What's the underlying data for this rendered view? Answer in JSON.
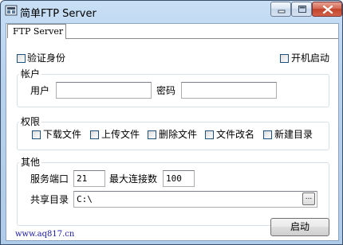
{
  "window": {
    "title": "简单FTP Server",
    "icon": "ftp-app-icon",
    "controls": [
      "minimize-icon",
      "maximize-icon",
      "close-icon"
    ]
  },
  "tabs": [
    {
      "label": "FTP Server",
      "selected": true
    }
  ],
  "options": {
    "auth": {
      "label": "验证身份",
      "checked": false
    },
    "autostart": {
      "label": "开机启动",
      "checked": false
    }
  },
  "account": {
    "title": "帐户",
    "user_label": "用户",
    "user_value": "",
    "password_label": "密码",
    "password_value": ""
  },
  "permissions": {
    "title": "权限",
    "items": [
      {
        "label": "下载文件",
        "checked": false
      },
      {
        "label": "上传文件",
        "checked": false
      },
      {
        "label": "删除文件",
        "checked": false
      },
      {
        "label": "文件改名",
        "checked": false
      },
      {
        "label": "新建目录",
        "checked": false
      }
    ]
  },
  "other": {
    "title": "其他",
    "port_label": "服务端口",
    "port_value": "21",
    "maxconn_label": "最大连接数",
    "maxconn_value": "100",
    "share_label": "共享目录",
    "share_value": "C:\\",
    "browse_label": "..."
  },
  "footer": {
    "link": "www.aq817.cn",
    "start_button": "启动"
  },
  "colors": {
    "titlebar": "#b9d3ee",
    "close_button": "#c2432a",
    "link": "#1a1aa6",
    "groupbox_border": "#d5dfe5"
  }
}
